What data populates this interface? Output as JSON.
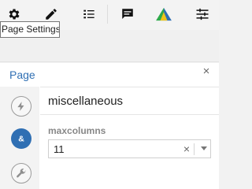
{
  "toolbar": {
    "tooltip": "Page Settings",
    "icons": [
      "gear-icon",
      "pencil-icon",
      "list-icon",
      "comment-icon",
      "app-logo-icon",
      "sliders-icon"
    ]
  },
  "panel": {
    "title": "Page",
    "close_glyph": "×",
    "name_value": "miscellaneous",
    "side_icons": [
      "lightning-icon",
      "ampersand-icon",
      "wrench-icon"
    ],
    "property": {
      "label": "maxcolumns",
      "value": "11",
      "clear_glyph": "×"
    }
  },
  "colors": {
    "accent": "#2f6fb3",
    "logo_green": "#2eaa4a",
    "logo_blue": "#2f6fb3"
  }
}
